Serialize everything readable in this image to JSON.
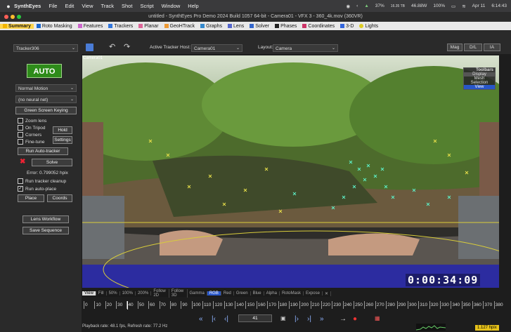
{
  "menubar": {
    "apple": "",
    "app": "SynthEyes",
    "items": [
      "File",
      "Edit",
      "View",
      "Track",
      "Shot",
      "Script",
      "Window",
      "Help"
    ],
    "status": {
      "battery_pct": "37%",
      "network": "46.88W",
      "network_top": "16.35 TB",
      "battery2": "100%",
      "date": "Apr 11",
      "time": "6:14:43"
    }
  },
  "window": {
    "title": "untitled - SynthEyes Pro Demo 2024 Build 1057 64-bit - Camera01 - VFX 3 - 360_4k.mov (360VR)"
  },
  "tabs": [
    {
      "label": "Summary",
      "color": "#f2b400",
      "active": true
    },
    {
      "label": "Roto Masking",
      "color": "#1a66cc"
    },
    {
      "label": "Features",
      "color": "#cc66cc"
    },
    {
      "label": "Trackers",
      "color": "#3377dd"
    },
    {
      "label": "Planar",
      "color": "#dd6699"
    },
    {
      "label": "GeoHTrack",
      "color": "#ee9933"
    },
    {
      "label": "Graphs",
      "color": "#3388cc"
    },
    {
      "label": "Lens",
      "color": "#5566cc"
    },
    {
      "label": "Solver",
      "color": "#3366cc"
    },
    {
      "label": "Phases",
      "color": "#222222"
    },
    {
      "label": "Coordinates",
      "color": "#cc3366"
    },
    {
      "label": "3-D",
      "color": "#3366dd"
    },
    {
      "label": "Lights",
      "color": "#ddcc22"
    }
  ],
  "toolbar": {
    "tracker_select": "Tracker306",
    "active_host_label": "Active Tracker Host:",
    "active_host": "Camera01",
    "layout_label": "Layout:",
    "layout": "Camera",
    "btn_mag": "Mag",
    "btn_dl": "D/L",
    "btn_ia": "IA"
  },
  "left": {
    "auto": "AUTO",
    "motion": "Normal Motion",
    "neural": "(no neural net)",
    "green_screen": "Green Screen Keying",
    "zoom_lens": "Zoom lens",
    "on_tripod": "On Tripod",
    "corners": "Corners",
    "fine_tune": "Fine-tune",
    "hold": "Hold",
    "settings": "Settings",
    "run_auto": "Run Auto-tracker",
    "solve": "Solve",
    "error": "Error: 0.799052 hpix",
    "cleanup": "Run tracker cleanup",
    "auto_place": "Run auto-place",
    "place": "Place",
    "coords": "Coords",
    "lens_workflow": "Lens Workflow",
    "save_sequence": "Save Sequence"
  },
  "viewport": {
    "camera_label": "Camera01",
    "timecode": "0:00:34:09",
    "toolbars": {
      "title": "Toolbars",
      "items": [
        "Display",
        "Mesh",
        "Selection",
        "View"
      ]
    }
  },
  "viewbar": [
    "View",
    "Fill",
    "50%",
    "100%",
    "200%",
    "Follow 2D",
    "Follow 3D",
    "Gamma",
    "RGB",
    "Red",
    "Green",
    "Blue",
    "Alpha",
    "RotoMask",
    "Expose",
    "✕"
  ],
  "ruler": [
    "0",
    "10",
    "20",
    "30",
    "40",
    "50",
    "60",
    "70",
    "80",
    "90",
    "100",
    "110",
    "120",
    "130",
    "140",
    "150",
    "160",
    "170",
    "180",
    "190",
    "200",
    "210",
    "220",
    "230",
    "240",
    "250",
    "260",
    "270",
    "280",
    "290",
    "300",
    "310",
    "320",
    "330",
    "340",
    "350",
    "360",
    "370",
    "380"
  ],
  "playback": {
    "frame": "41",
    "status": "Playback rate: 48.1 fps, Refresh rate: 77.2 Hz",
    "hpix": "1.127 hpix"
  }
}
